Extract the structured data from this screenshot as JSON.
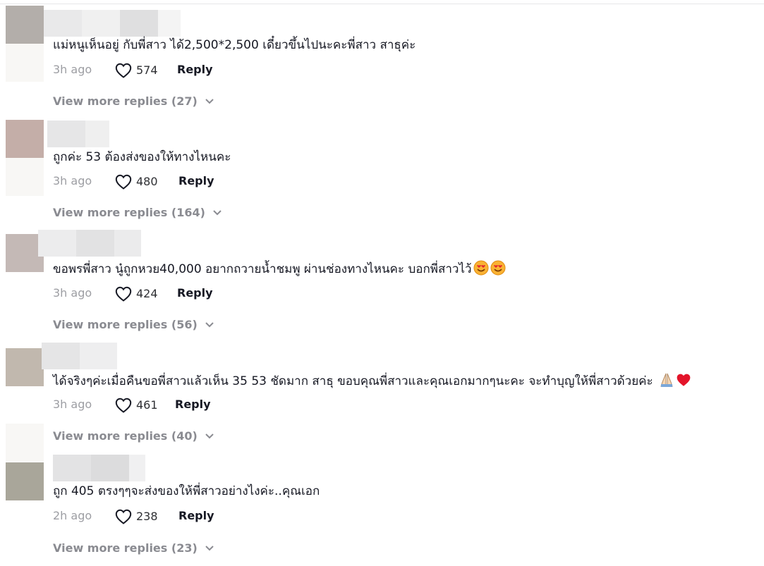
{
  "comments": [
    {
      "text": "แม่หนูเห็นอยู่ กับพี่สาว ได้2,500*2,500 เดี๋ยวขึ้นไปนะคะพี่สาว สาธุค่ะ",
      "time": "3h ago",
      "likes": "574",
      "reply_label": "Reply",
      "view_more": "View more replies (27)",
      "avatar_color": "#b3aeaa",
      "emojis": []
    },
    {
      "text": "ถูกค่ะ 53 ต้องส่งของให้ทางไหนคะ",
      "time": "3h ago",
      "likes": "480",
      "reply_label": "Reply",
      "view_more": "View more replies (164)",
      "avatar_color": "#c4aea8",
      "emojis": []
    },
    {
      "text": "ขอพรพี่สาว นู๋ถูกหวย40,000 อยากถวายน้ำชมพู ผ่านช่องทางไหนคะ บอกพี่สาวไว้",
      "time": "3h ago",
      "likes": "424",
      "reply_label": "Reply",
      "view_more": "View more replies (56)",
      "avatar_color": "#c4b9b6",
      "emojis": [
        "smiling-face-with-hearts-icon",
        "smiling-face-with-hearts-icon"
      ]
    },
    {
      "text": "ได้จริงๆค่ะเมื่อคืนขอพี่สาวแล้วเห็น 35 53 ชัดมาก สาธุ ขอบคุณพี่สาวและคุณเอกมากๆนะคะ จะทำบุญให้พี่สาวด้วยค่ะ",
      "time": "3h ago",
      "likes": "461",
      "reply_label": "Reply",
      "view_more": "View more replies (40)",
      "avatar_color": "#c1b8ae",
      "emojis": [
        "folded-hands-icon",
        "red-heart-icon"
      ]
    },
    {
      "text": "ถูก 405 ตรงๆๆจะส่งของให้พี่สาวอย่างไงค่ะ..คุณเอก",
      "time": "2h ago",
      "likes": "238",
      "reply_label": "Reply",
      "view_more": "View more replies (23)",
      "avatar_color": "#a9a69a",
      "emojis": []
    }
  ],
  "colors": {
    "text": "#161823",
    "muted": "#9d9ea3",
    "view_more": "#8a8b91",
    "heart_outline": "#161823"
  }
}
